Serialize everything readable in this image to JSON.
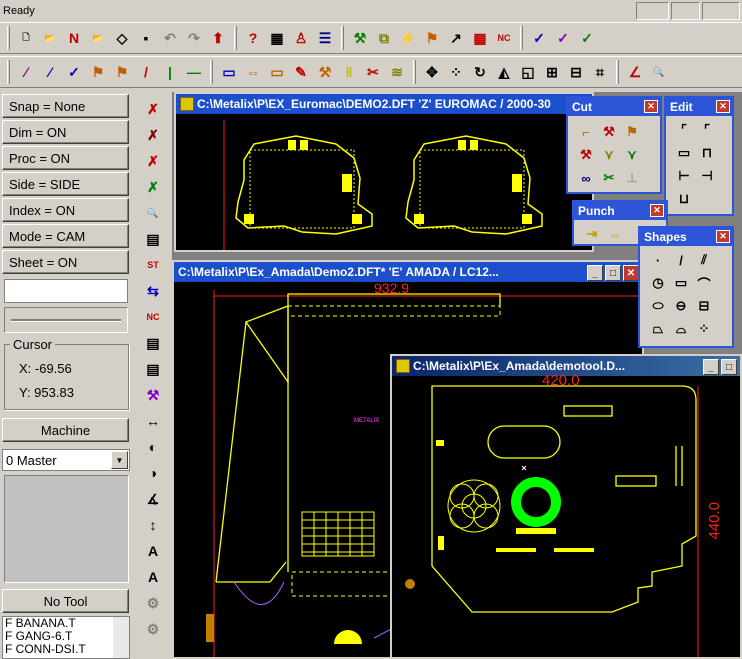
{
  "status": {
    "text": "Ready"
  },
  "toolbar1": {
    "icons": [
      {
        "name": "new-icon",
        "glyph": "🗋",
        "color": "#000000"
      },
      {
        "name": "open-icon",
        "glyph": "📂",
        "color": "#b08000"
      },
      {
        "name": "nc-open-icon",
        "glyph": "N",
        "color": "#c00000"
      },
      {
        "name": "open-folder-icon",
        "glyph": "📂",
        "color": "#b08000"
      },
      {
        "name": "import-icon",
        "glyph": "◇",
        "color": "#000000"
      },
      {
        "name": "save-icon",
        "glyph": "▪",
        "color": "#000000"
      },
      {
        "name": "undo-icon",
        "glyph": "↶",
        "color": "#808080"
      },
      {
        "name": "redo-icon",
        "glyph": "↷",
        "color": "#808080"
      },
      {
        "name": "export-icon",
        "glyph": "⬆",
        "color": "#c00000"
      },
      {
        "name": "help-icon",
        "glyph": "?",
        "color": "#c00000"
      },
      {
        "name": "table-icon",
        "glyph": "▦",
        "color": "#000000"
      },
      {
        "name": "person-icon",
        "glyph": "♙",
        "color": "#c00000"
      },
      {
        "name": "layers-icon",
        "glyph": "☰",
        "color": "#000080"
      },
      {
        "name": "tool-icon",
        "glyph": "⚒",
        "color": "#008000"
      },
      {
        "name": "copy-icon",
        "glyph": "⧉",
        "color": "#808000"
      },
      {
        "name": "auto-icon",
        "glyph": "⚡",
        "color": "#c00000"
      },
      {
        "name": "punch-icon",
        "glyph": "⚑",
        "color": "#c06000"
      },
      {
        "name": "tooling-icon",
        "glyph": "↗",
        "color": "#000000"
      },
      {
        "name": "grid-icon",
        "glyph": "▦",
        "color": "#c00000"
      },
      {
        "name": "nc-icon",
        "glyph": "NC",
        "color": "#c00000"
      },
      {
        "name": "checkmark-icon",
        "glyph": "✓",
        "color": "#0000c0"
      },
      {
        "name": "checkmark2-icon",
        "glyph": "✓",
        "color": "#8000c0"
      },
      {
        "name": "checkmark3-icon",
        "glyph": "✓",
        "color": "#008000"
      }
    ]
  },
  "toolbar2": {
    "icons": [
      {
        "name": "draw-line-icon",
        "glyph": "⁄",
        "color": "#800080"
      },
      {
        "name": "draw-line2-icon",
        "glyph": "⁄",
        "color": "#0000c0"
      },
      {
        "name": "check-icon",
        "glyph": "✓",
        "color": "#0000c0"
      },
      {
        "name": "dims-icon",
        "glyph": "⚑",
        "color": "#c06000"
      },
      {
        "name": "dims2-icon",
        "glyph": "⚑",
        "color": "#c06000"
      },
      {
        "name": "slant-icon",
        "glyph": "/",
        "color": "#c00000"
      },
      {
        "name": "vertical-icon",
        "glyph": "|",
        "color": "#008000"
      },
      {
        "name": "horizontal-icon",
        "glyph": "—",
        "color": "#008000"
      },
      {
        "name": "frame-icon",
        "glyph": "▭",
        "color": "#0000c0"
      },
      {
        "name": "mirror-icon",
        "glyph": "⇔",
        "color": "#c06000"
      },
      {
        "name": "plate-icon",
        "glyph": "▭",
        "color": "#c06000"
      },
      {
        "name": "brush-icon",
        "glyph": "✎",
        "color": "#c00000"
      },
      {
        "name": "hammer-icon",
        "glyph": "⚒",
        "color": "#c06000"
      },
      {
        "name": "bars-icon",
        "glyph": "‖",
        "color": "#c0c000"
      },
      {
        "name": "cut-icon",
        "glyph": "✂",
        "color": "#c00000"
      },
      {
        "name": "stack-icon",
        "glyph": "≋",
        "color": "#808000"
      },
      {
        "name": "move-icon",
        "glyph": "✥",
        "color": "#000000"
      },
      {
        "name": "copy-circles-icon",
        "glyph": "⁘",
        "color": "#000000"
      },
      {
        "name": "rotate-icon",
        "glyph": "↻",
        "color": "#000000"
      },
      {
        "name": "mirror-tri-icon",
        "glyph": "◭",
        "color": "#000000"
      },
      {
        "name": "scale-icon",
        "glyph": "◱",
        "color": "#000000"
      },
      {
        "name": "array-icon",
        "glyph": "⊞",
        "color": "#000000"
      },
      {
        "name": "offset-icon",
        "glyph": "⊟",
        "color": "#000000"
      },
      {
        "name": "nest-icon",
        "glyph": "⌗",
        "color": "#000000"
      },
      {
        "name": "measure-icon",
        "glyph": "∠",
        "color": "#c00000"
      },
      {
        "name": "zoom-icon",
        "glyph": "🔍",
        "color": "#000080"
      }
    ]
  },
  "panel": {
    "snap": "Snap = None",
    "dim": "Dim   = ON",
    "proc": "Proc  = ON",
    "side": "Side  = SIDE",
    "index": "Index = ON",
    "mode": "Mode = CAM",
    "sheet": "Sheet = ON",
    "cursor_title": "Cursor",
    "cursor_x": "X:   -69.56",
    "cursor_y": "Y:   953.83",
    "machine": "Machine",
    "master": "0 Master",
    "no_tool": "No Tool",
    "tools": [
      "F BANANA.T",
      "F GANG-6.T",
      "F CONN-DSI.T"
    ]
  },
  "vtoolbar": {
    "icons": [
      {
        "name": "delete-icon",
        "glyph": "✗",
        "color": "#c00000"
      },
      {
        "name": "delete-cut-icon",
        "glyph": "✗",
        "color": "#800000"
      },
      {
        "name": "delete-punch-icon",
        "glyph": "✗",
        "color": "#c00000"
      },
      {
        "name": "delete-all-icon",
        "glyph": "✗",
        "color": "#008000"
      },
      {
        "name": "preview-icon",
        "glyph": "🔍",
        "color": "#000000"
      },
      {
        "name": "sheet-icon",
        "glyph": "▤",
        "color": "#000000"
      },
      {
        "name": "st-icon",
        "glyph": "ST",
        "color": "#c00000"
      },
      {
        "name": "swap-icon",
        "glyph": "⇆",
        "color": "#0000c0"
      },
      {
        "name": "nc-gen-icon",
        "glyph": "NC",
        "color": "#c00000"
      },
      {
        "name": "document-icon",
        "glyph": "▤",
        "color": "#000000"
      },
      {
        "name": "document2-icon",
        "glyph": "▤",
        "color": "#000000"
      },
      {
        "name": "tool-select-icon",
        "glyph": "⚒",
        "color": "#8000c0"
      },
      {
        "name": "distance-icon",
        "glyph": "↔",
        "color": "#000000"
      },
      {
        "name": "circle-arrow-icon",
        "glyph": "◐",
        "color": "#000000"
      },
      {
        "name": "circle-arrow2-icon",
        "glyph": "◑",
        "color": "#000000"
      },
      {
        "name": "angle-icon",
        "glyph": "∡",
        "color": "#000000"
      },
      {
        "name": "dist-v-icon",
        "glyph": "↕",
        "color": "#000000"
      },
      {
        "name": "text-a-icon",
        "glyph": "A",
        "color": "#000000"
      },
      {
        "name": "text-a2-icon",
        "glyph": "A",
        "color": "#000000"
      },
      {
        "name": "misc-icon",
        "glyph": "⚙",
        "color": "#808080"
      },
      {
        "name": "misc2-icon",
        "glyph": "⚙",
        "color": "#808080"
      }
    ]
  },
  "win1": {
    "title": "C:\\Metalix\\P\\EX_Euromac\\DEMO2.DFT  'Z'  EUROMAC / 2000-30"
  },
  "win2": {
    "title": "C:\\Metalix\\P\\Ex_Amada\\Demo2.DFT*  'E'  AMADA / LC12...",
    "dim_top": "932.9",
    "label": "METALIX"
  },
  "win3": {
    "title": "C:\\Metalix\\P\\Ex_Amada\\demotool.D...",
    "dim_top": "420.0",
    "dim_right": "440.0"
  },
  "palettes": {
    "cut": {
      "title": "Cut",
      "close": "✕"
    },
    "edit": {
      "title": "Edit",
      "close": "✕"
    },
    "punch": {
      "title": "Punch",
      "close": "✕"
    },
    "shapes": {
      "title": "Shapes",
      "close": "✕"
    }
  },
  "colors": {
    "yellow": "#ffff00",
    "green": "#00ff00",
    "red": "#ff2020",
    "magenta": "#ff40ff",
    "title_active": "#0a246a",
    "title_blue": "#2d55d8"
  }
}
